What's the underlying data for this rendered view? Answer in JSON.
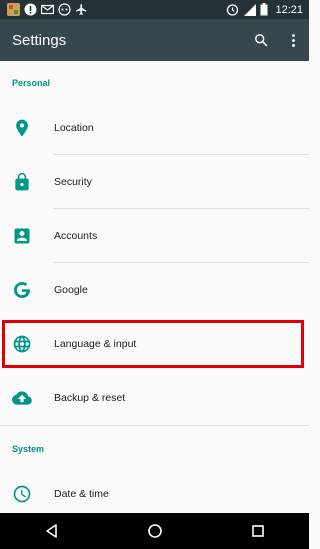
{
  "status_bar": {
    "time": "12:21",
    "left_icons": [
      "app-icon",
      "warning-icon",
      "gmail-icon",
      "bubble-icon",
      "airplane-mode-icon"
    ],
    "right_icons": [
      "alarm-icon",
      "lte-signal-icon",
      "battery-icon"
    ]
  },
  "app_bar": {
    "title": "Settings",
    "actions": [
      "search-icon",
      "more-vert-icon"
    ]
  },
  "sections": [
    {
      "header": "Personal",
      "items": [
        {
          "label": "Location",
          "icon": "location-pin-icon"
        },
        {
          "label": "Security",
          "icon": "lock-icon"
        },
        {
          "label": "Accounts",
          "icon": "account-box-icon"
        },
        {
          "label": "Google",
          "icon": "google-icon"
        },
        {
          "label": "Language & input",
          "icon": "globe-icon",
          "highlighted": true
        },
        {
          "label": "Backup & reset",
          "icon": "cloud-upload-icon"
        }
      ]
    },
    {
      "header": "System",
      "items": [
        {
          "label": "Date & time",
          "icon": "clock-icon"
        }
      ]
    }
  ],
  "nav_bar": {
    "buttons": [
      "back-icon",
      "home-icon",
      "recents-icon"
    ]
  },
  "colors": {
    "status_bar": "#263238",
    "app_bar": "#37474f",
    "accent": "#009688",
    "highlight_border": "#e0000b",
    "background": "#fafafa"
  }
}
